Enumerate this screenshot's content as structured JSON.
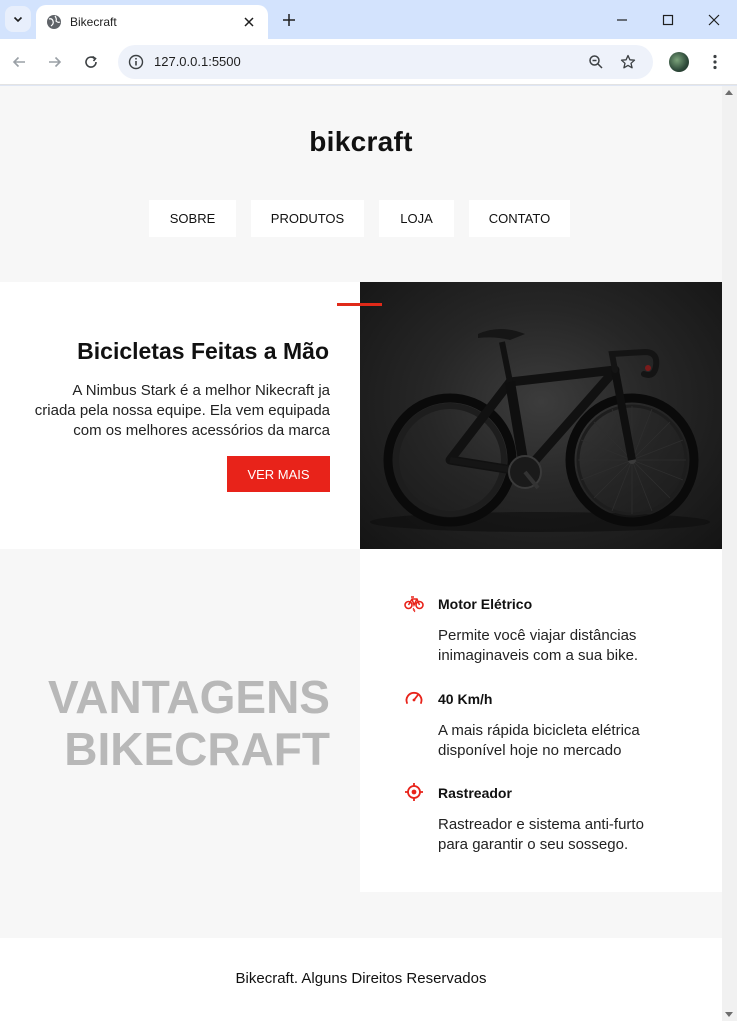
{
  "browser": {
    "tab_title": "Bikecraft",
    "url": "127.0.0.1:5500"
  },
  "header": {
    "logo": "bikcraft",
    "menu": [
      "SOBRE",
      "PRODUTOS",
      "LOJA",
      "CONTATO"
    ]
  },
  "intro": {
    "title": "Bicicletas Feitas a Mão",
    "text": "A Nimbus Stark é a melhor Nikecraft ja criada pela nossa equipe. Ela vem equipada com os melhores acessórios da marca",
    "button_label": "VER MAIS"
  },
  "advantages": {
    "title_line1": "VANTAGENS",
    "title_line2": "BIKECRAFT",
    "features": [
      {
        "icon": "electric-bike-icon",
        "title": "Motor Elétrico",
        "text": "Permite você viajar distâncias inimaginaveis com a sua bike."
      },
      {
        "icon": "speedometer-icon",
        "title": "40 Km/h",
        "text": "A mais rápida bicicleta elétrica disponível hoje no mercado"
      },
      {
        "icon": "target-icon",
        "title": "Rastreador",
        "text": "Rastreador e sistema anti-furto para garantir o seu sossego."
      }
    ]
  },
  "footer": {
    "text": "Bikecraft. Alguns Direitos Reservados"
  },
  "colors": {
    "accent": "#e8231a",
    "muted_heading": "#b8b8b8",
    "tabbar": "#d3e3fd"
  }
}
